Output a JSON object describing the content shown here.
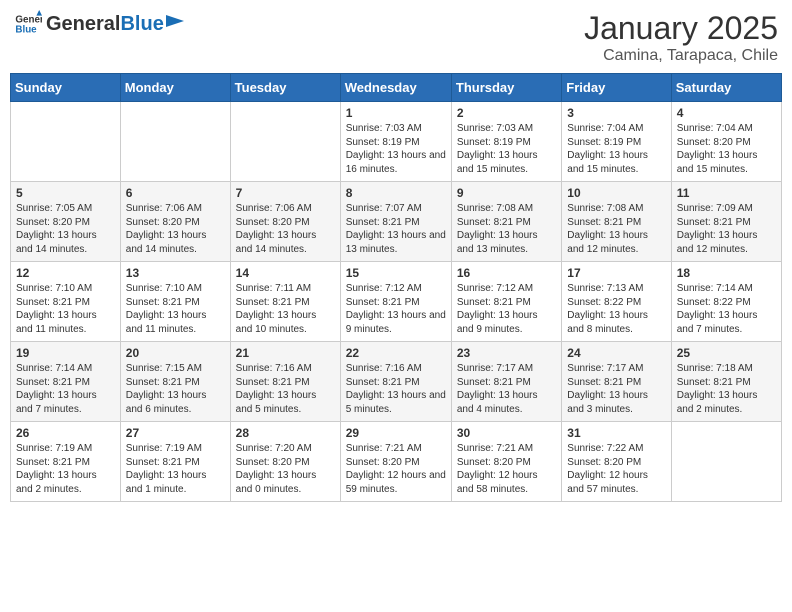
{
  "header": {
    "logo_general": "General",
    "logo_blue": "Blue",
    "month_title": "January 2025",
    "subtitle": "Camina, Tarapaca, Chile"
  },
  "days_of_week": [
    "Sunday",
    "Monday",
    "Tuesday",
    "Wednesday",
    "Thursday",
    "Friday",
    "Saturday"
  ],
  "weeks": [
    [
      {
        "day": "",
        "info": ""
      },
      {
        "day": "",
        "info": ""
      },
      {
        "day": "",
        "info": ""
      },
      {
        "day": "1",
        "info": "Sunrise: 7:03 AM\nSunset: 8:19 PM\nDaylight: 13 hours\nand 16 minutes."
      },
      {
        "day": "2",
        "info": "Sunrise: 7:03 AM\nSunset: 8:19 PM\nDaylight: 13 hours\nand 15 minutes."
      },
      {
        "day": "3",
        "info": "Sunrise: 7:04 AM\nSunset: 8:19 PM\nDaylight: 13 hours\nand 15 minutes."
      },
      {
        "day": "4",
        "info": "Sunrise: 7:04 AM\nSunset: 8:20 PM\nDaylight: 13 hours\nand 15 minutes."
      }
    ],
    [
      {
        "day": "5",
        "info": "Sunrise: 7:05 AM\nSunset: 8:20 PM\nDaylight: 13 hours\nand 14 minutes."
      },
      {
        "day": "6",
        "info": "Sunrise: 7:06 AM\nSunset: 8:20 PM\nDaylight: 13 hours\nand 14 minutes."
      },
      {
        "day": "7",
        "info": "Sunrise: 7:06 AM\nSunset: 8:20 PM\nDaylight: 13 hours\nand 14 minutes."
      },
      {
        "day": "8",
        "info": "Sunrise: 7:07 AM\nSunset: 8:21 PM\nDaylight: 13 hours\nand 13 minutes."
      },
      {
        "day": "9",
        "info": "Sunrise: 7:08 AM\nSunset: 8:21 PM\nDaylight: 13 hours\nand 13 minutes."
      },
      {
        "day": "10",
        "info": "Sunrise: 7:08 AM\nSunset: 8:21 PM\nDaylight: 13 hours\nand 12 minutes."
      },
      {
        "day": "11",
        "info": "Sunrise: 7:09 AM\nSunset: 8:21 PM\nDaylight: 13 hours\nand 12 minutes."
      }
    ],
    [
      {
        "day": "12",
        "info": "Sunrise: 7:10 AM\nSunset: 8:21 PM\nDaylight: 13 hours\nand 11 minutes."
      },
      {
        "day": "13",
        "info": "Sunrise: 7:10 AM\nSunset: 8:21 PM\nDaylight: 13 hours\nand 11 minutes."
      },
      {
        "day": "14",
        "info": "Sunrise: 7:11 AM\nSunset: 8:21 PM\nDaylight: 13 hours\nand 10 minutes."
      },
      {
        "day": "15",
        "info": "Sunrise: 7:12 AM\nSunset: 8:21 PM\nDaylight: 13 hours\nand 9 minutes."
      },
      {
        "day": "16",
        "info": "Sunrise: 7:12 AM\nSunset: 8:21 PM\nDaylight: 13 hours\nand 9 minutes."
      },
      {
        "day": "17",
        "info": "Sunrise: 7:13 AM\nSunset: 8:22 PM\nDaylight: 13 hours\nand 8 minutes."
      },
      {
        "day": "18",
        "info": "Sunrise: 7:14 AM\nSunset: 8:22 PM\nDaylight: 13 hours\nand 7 minutes."
      }
    ],
    [
      {
        "day": "19",
        "info": "Sunrise: 7:14 AM\nSunset: 8:21 PM\nDaylight: 13 hours\nand 7 minutes."
      },
      {
        "day": "20",
        "info": "Sunrise: 7:15 AM\nSunset: 8:21 PM\nDaylight: 13 hours\nand 6 minutes."
      },
      {
        "day": "21",
        "info": "Sunrise: 7:16 AM\nSunset: 8:21 PM\nDaylight: 13 hours\nand 5 minutes."
      },
      {
        "day": "22",
        "info": "Sunrise: 7:16 AM\nSunset: 8:21 PM\nDaylight: 13 hours\nand 5 minutes."
      },
      {
        "day": "23",
        "info": "Sunrise: 7:17 AM\nSunset: 8:21 PM\nDaylight: 13 hours\nand 4 minutes."
      },
      {
        "day": "24",
        "info": "Sunrise: 7:17 AM\nSunset: 8:21 PM\nDaylight: 13 hours\nand 3 minutes."
      },
      {
        "day": "25",
        "info": "Sunrise: 7:18 AM\nSunset: 8:21 PM\nDaylight: 13 hours\nand 2 minutes."
      }
    ],
    [
      {
        "day": "26",
        "info": "Sunrise: 7:19 AM\nSunset: 8:21 PM\nDaylight: 13 hours\nand 2 minutes."
      },
      {
        "day": "27",
        "info": "Sunrise: 7:19 AM\nSunset: 8:21 PM\nDaylight: 13 hours\nand 1 minute."
      },
      {
        "day": "28",
        "info": "Sunrise: 7:20 AM\nSunset: 8:20 PM\nDaylight: 13 hours\nand 0 minutes."
      },
      {
        "day": "29",
        "info": "Sunrise: 7:21 AM\nSunset: 8:20 PM\nDaylight: 12 hours\nand 59 minutes."
      },
      {
        "day": "30",
        "info": "Sunrise: 7:21 AM\nSunset: 8:20 PM\nDaylight: 12 hours\nand 58 minutes."
      },
      {
        "day": "31",
        "info": "Sunrise: 7:22 AM\nSunset: 8:20 PM\nDaylight: 12 hours\nand 57 minutes."
      },
      {
        "day": "",
        "info": ""
      }
    ]
  ]
}
